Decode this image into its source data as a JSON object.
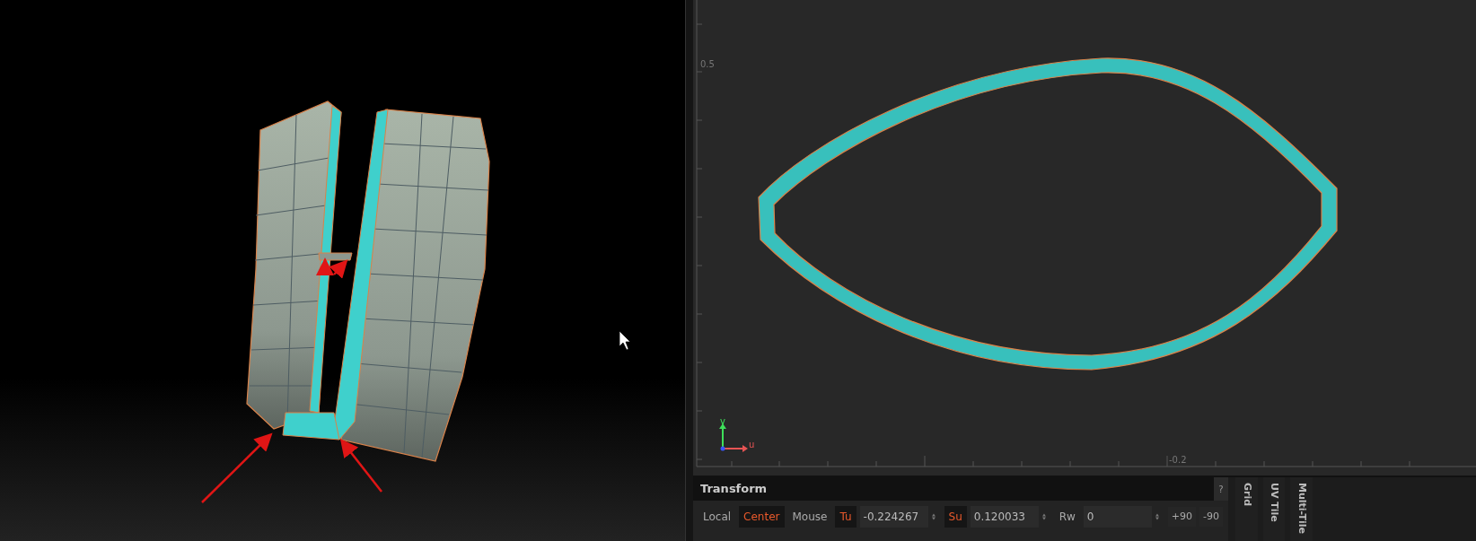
{
  "uv_editor": {
    "v_ticks": [
      "0.5"
    ],
    "u_ticks": [
      "-0.2"
    ],
    "axis_labels": [
      "v",
      "u"
    ]
  },
  "transform": {
    "title": "Transform",
    "help": "?",
    "modes": [
      {
        "label": "Local",
        "selected": false
      },
      {
        "label": "Center",
        "selected": true
      },
      {
        "label": "Mouse",
        "selected": false
      }
    ],
    "fields": [
      {
        "label": "Tu",
        "value": "-0.224267",
        "kind": "axis"
      },
      {
        "label": "Su",
        "value": "0.120033",
        "kind": "axis"
      },
      {
        "label": "Rw",
        "value": "0",
        "kind": "plain"
      }
    ],
    "rotate_buttons": [
      "+90",
      "-90"
    ]
  },
  "side_tabs": [
    "Grid",
    "UV Tile",
    "Multi-Tile"
  ]
}
